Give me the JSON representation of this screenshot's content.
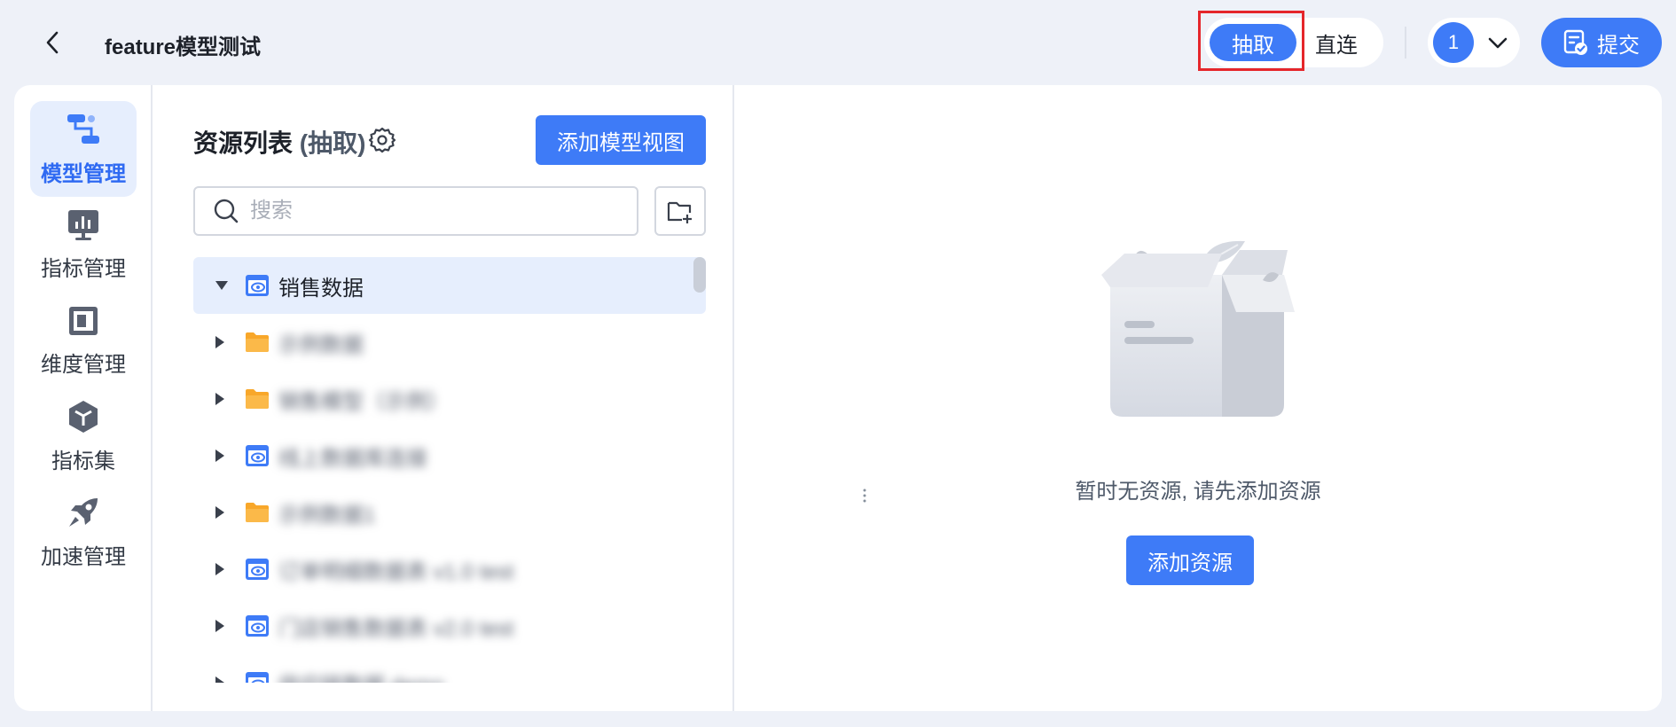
{
  "header": {
    "title": "feature模型测试",
    "modes": {
      "extract_label": "抽取",
      "direct_label": "直连",
      "active": "抽取"
    },
    "version": "1",
    "submit_label": "提交"
  },
  "nav": {
    "items": [
      {
        "label": "模型管理",
        "icon": "model-icon",
        "active": true
      },
      {
        "label": "指标管理",
        "icon": "metric-icon",
        "active": false
      },
      {
        "label": "维度管理",
        "icon": "dimension-icon",
        "active": false
      },
      {
        "label": "指标集",
        "icon": "cube-icon",
        "active": false
      },
      {
        "label": "加速管理",
        "icon": "rocket-icon",
        "active": false
      }
    ]
  },
  "resources": {
    "title": "资源列表",
    "title_suffix": "(抽取)",
    "add_view_label": "添加模型视图",
    "search_placeholder": "搜索",
    "tree": [
      {
        "label": "销售数据",
        "type": "view",
        "expanded": true,
        "selected": true
      },
      {
        "label": "示例数据",
        "type": "folder",
        "blurred": true
      },
      {
        "label": "销售模型（示例）",
        "type": "folder",
        "blurred": true
      },
      {
        "label": "线上数据库连接",
        "type": "view",
        "blurred": true
      },
      {
        "label": "示例数据1",
        "type": "folder",
        "blurred": true
      },
      {
        "label": "订单明细数据表 v1.0 test",
        "type": "view",
        "blurred": true
      },
      {
        "label": "门店销售数据表 v2.0 test",
        "type": "view",
        "blurred": true
      },
      {
        "label": "供应链数据 demo",
        "type": "view",
        "blurred": true
      }
    ]
  },
  "empty_state": {
    "message": "暂时无资源, 请先添加资源",
    "button_label": "添加资源"
  },
  "colors": {
    "primary": "#3e7bf7",
    "nav_active_bg": "#e6eefd",
    "highlight": "#e5262b",
    "folder": "#f8a72a"
  }
}
